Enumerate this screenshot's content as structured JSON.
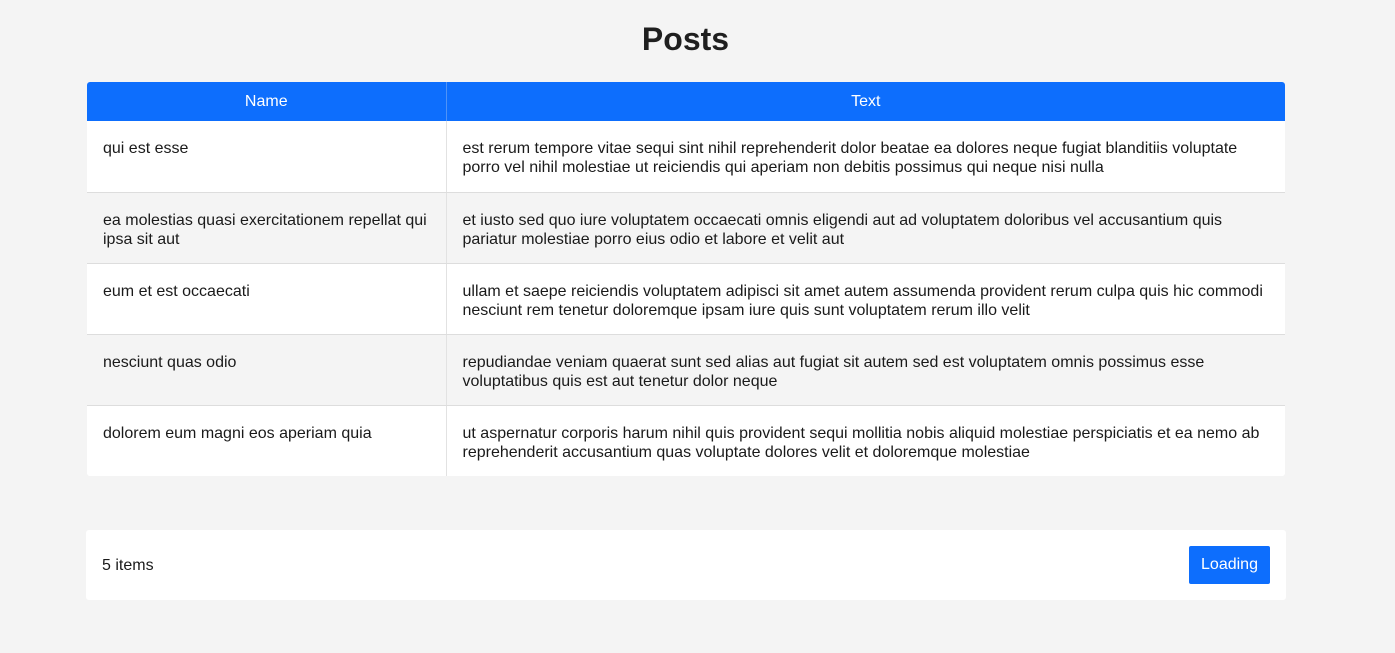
{
  "page": {
    "title": "Posts"
  },
  "table": {
    "headers": [
      "Name",
      "Text"
    ],
    "rows": [
      {
        "name": "qui est esse",
        "text": "est rerum tempore vitae sequi sint nihil reprehenderit dolor beatae ea dolores neque fugiat blanditiis voluptate porro vel nihil molestiae ut reiciendis qui aperiam non debitis possimus qui neque nisi nulla"
      },
      {
        "name": "ea molestias quasi exercitationem repellat qui ipsa sit aut",
        "text": "et iusto sed quo iure voluptatem occaecati omnis eligendi aut ad voluptatem doloribus vel accusantium quis pariatur molestiae porro eius odio et labore et velit aut"
      },
      {
        "name": "eum et est occaecati",
        "text": "ullam et saepe reiciendis voluptatem adipisci sit amet autem assumenda provident rerum culpa quis hic commodi nesciunt rem tenetur doloremque ipsam iure quis sunt voluptatem rerum illo velit"
      },
      {
        "name": "nesciunt quas odio",
        "text": "repudiandae veniam quaerat sunt sed alias aut fugiat sit autem sed est voluptatem omnis possimus esse voluptatibus quis est aut tenetur dolor neque"
      },
      {
        "name": "dolorem eum magni eos aperiam quia",
        "text": "ut aspernatur corporis harum nihil quis provident sequi mollitia nobis aliquid molestiae perspiciatis et ea nemo ab reprehenderit accusantium quas voluptate dolores velit et doloremque molestiae"
      }
    ]
  },
  "footer": {
    "items_count": "5 items",
    "load_button_label": "Loading"
  },
  "colors": {
    "accent": "#0d6efd",
    "background": "#f4f4f4",
    "row_alt": "#f4f4f4"
  }
}
